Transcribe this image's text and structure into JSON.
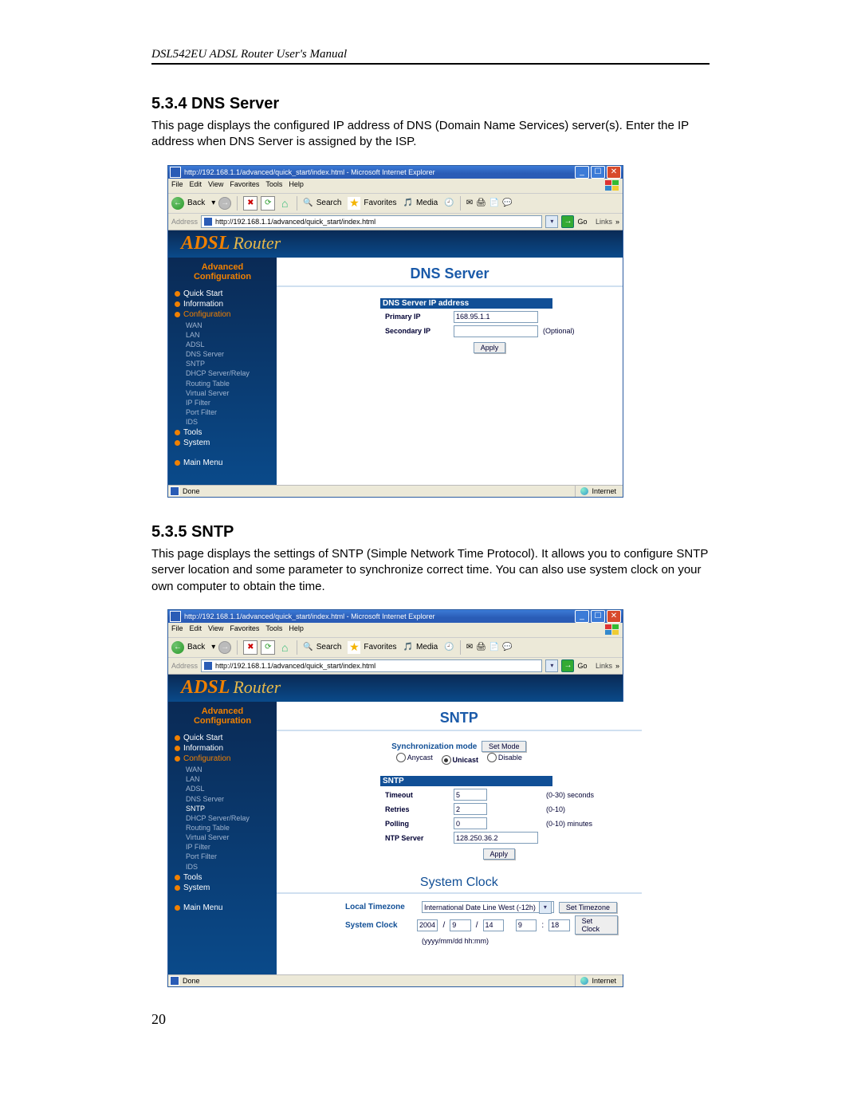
{
  "manual_header": "DSL542EU ADSL Router User's Manual",
  "page_number": "20",
  "sections": {
    "dns": {
      "heading": "5.3.4  DNS Server",
      "body": "This page displays the configured IP address of DNS (Domain Name Services) server(s). Enter the IP address when DNS Server is assigned by the ISP."
    },
    "sntp": {
      "heading": "5.3.5  SNTP",
      "body": "This page displays the settings of SNTP (Simple Network Time Protocol). It allows you to configure SNTP server location and some parameter to synchronize correct time. You can also use system clock on your own computer to obtain the time."
    }
  },
  "browser": {
    "title": "http://192.168.1.1/advanced/quick_start/index.html - Microsoft Internet Explorer",
    "menus": {
      "file": "File",
      "edit": "Edit",
      "view": "View",
      "favorites": "Favorites",
      "tools": "Tools",
      "help": "Help"
    },
    "toolbar": {
      "back": "Back",
      "search": "Search",
      "favorites": "Favorites",
      "media": "Media"
    },
    "address_label": "Address",
    "url": "http://192.168.1.1/advanced/quick_start/index.html",
    "go_label": "Go",
    "links_label": "Links",
    "status_done": "Done",
    "status_zone": "Internet"
  },
  "router": {
    "logo_a": "ADSL",
    "logo_r": "Router",
    "sidebar_title_1": "Advanced",
    "sidebar_title_2": "Configuration",
    "items": {
      "quick_start": "Quick Start",
      "information": "Information",
      "configuration": "Configuration",
      "tools": "Tools",
      "system": "System",
      "main_menu": "Main Menu"
    },
    "config_sub": {
      "wan": "WAN",
      "lan": "LAN",
      "adsl": "ADSL",
      "dns": "DNS Server",
      "sntp": "SNTP",
      "dhcp": "DHCP Server/Relay",
      "routing": "Routing Table",
      "virtual": "Virtual Server",
      "ipfilter": "IP Filter",
      "portfilter": "Port Filter",
      "ids": "IDS"
    }
  },
  "dns_page": {
    "title": "DNS Server",
    "table_header": "DNS Server IP address",
    "primary_label": "Primary IP",
    "primary_value": "168.95.1.1",
    "secondary_label": "Secondary IP",
    "secondary_value": "",
    "optional": "(Optional)",
    "apply": "Apply"
  },
  "sntp_page": {
    "title": "SNTP",
    "sync_label": "Synchronization mode",
    "set_mode": "Set Mode",
    "mode_anycast": "Anycast",
    "mode_unicast": "Unicast",
    "mode_disable": "Disable",
    "sntp_header": "SNTP",
    "timeout_label": "Timeout",
    "timeout_value": "5",
    "timeout_hint": "(0-30) seconds",
    "retries_label": "Retries",
    "retries_value": "2",
    "retries_hint": "(0-10)",
    "polling_label": "Polling",
    "polling_value": "0",
    "polling_hint": "(0-10) minutes",
    "ntp_label": "NTP Server",
    "ntp_value": "128.250.36.2",
    "apply": "Apply",
    "sysclock_title": "System Clock",
    "tz_label": "Local Timezone",
    "tz_value": "International Date Line West (-12h)",
    "set_tz": "Set Timezone",
    "sysclock_label": "System Clock",
    "y": "2004",
    "mo": "9",
    "d": "14",
    "h": "9",
    "mi": "18",
    "set_clock": "Set Clock",
    "format_hint": "(yyyy/mm/dd hh:mm)"
  }
}
